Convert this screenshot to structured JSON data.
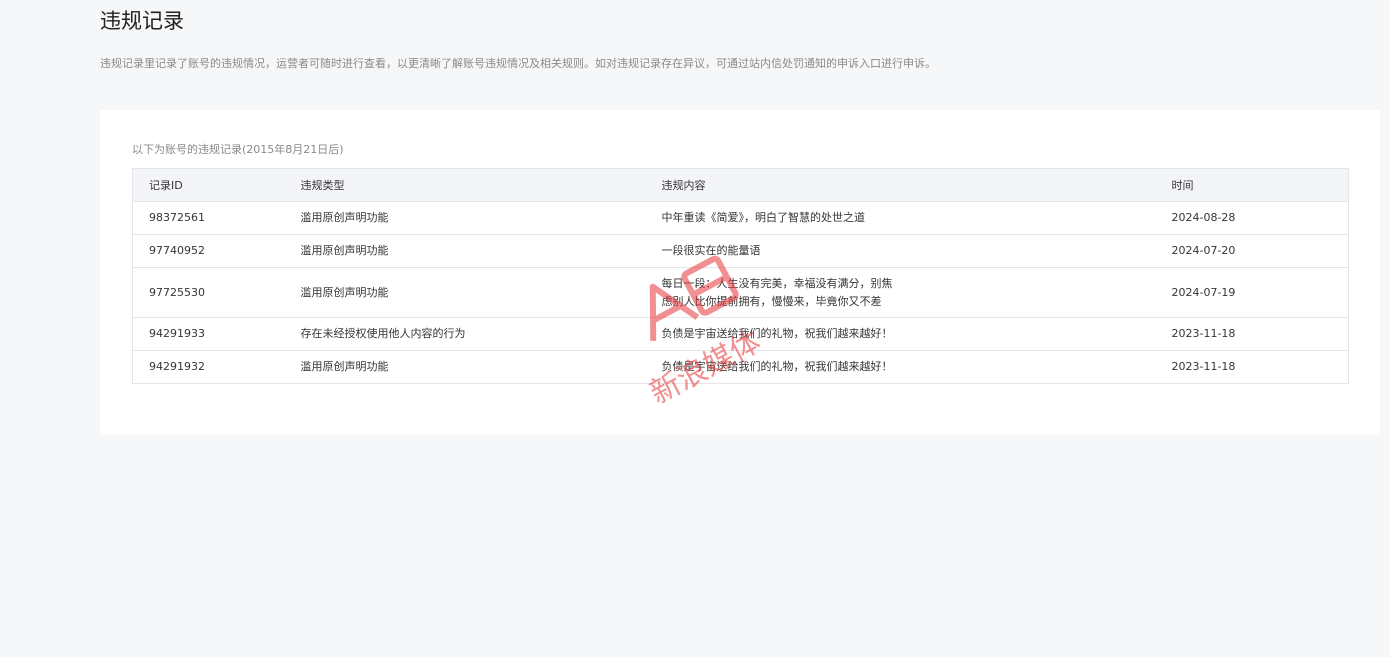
{
  "page": {
    "title": "违规记录",
    "description": "违规记录里记录了账号的违规情况，运营者可随时进行查看，以更清晰了解账号违规情况及相关规则。如对违规记录存在异议，可通过站内信处罚通知的申诉入口进行申诉。"
  },
  "panel": {
    "caption": "以下为账号的违规记录(2015年8月21日后)"
  },
  "table": {
    "headers": [
      "记录ID",
      "违规类型",
      "违规内容",
      "时间"
    ],
    "rows": [
      {
        "id": "98372561",
        "type": "滥用原创声明功能",
        "content": "中年重读《简爱》，明白了智慧的处世之道",
        "time": "2024-08-28"
      },
      {
        "id": "97740952",
        "type": "滥用原创声明功能",
        "content": "一段很实在的能量语",
        "time": "2024-07-20"
      },
      {
        "id": "97725530",
        "type": "滥用原创声明功能",
        "content": "每日一段：人生没有完美，幸福没有满分，别焦\n虑别人比你提前拥有，慢慢来，毕竟你又不差",
        "time": "2024-07-19"
      },
      {
        "id": "94291933",
        "type": "存在未经授权使用他人内容的行为",
        "content": "负债是宇宙送给我们的礼物，祝我们越来越好！",
        "time": "2023-11-18"
      },
      {
        "id": "94291932",
        "type": "滥用原创声明功能",
        "content": "负债是宇宙送给我们的礼物，祝我们越来越好！",
        "time": "2023-11-18"
      }
    ]
  },
  "watermark": {
    "text": "新浪媒体",
    "color": "#e8353a"
  }
}
